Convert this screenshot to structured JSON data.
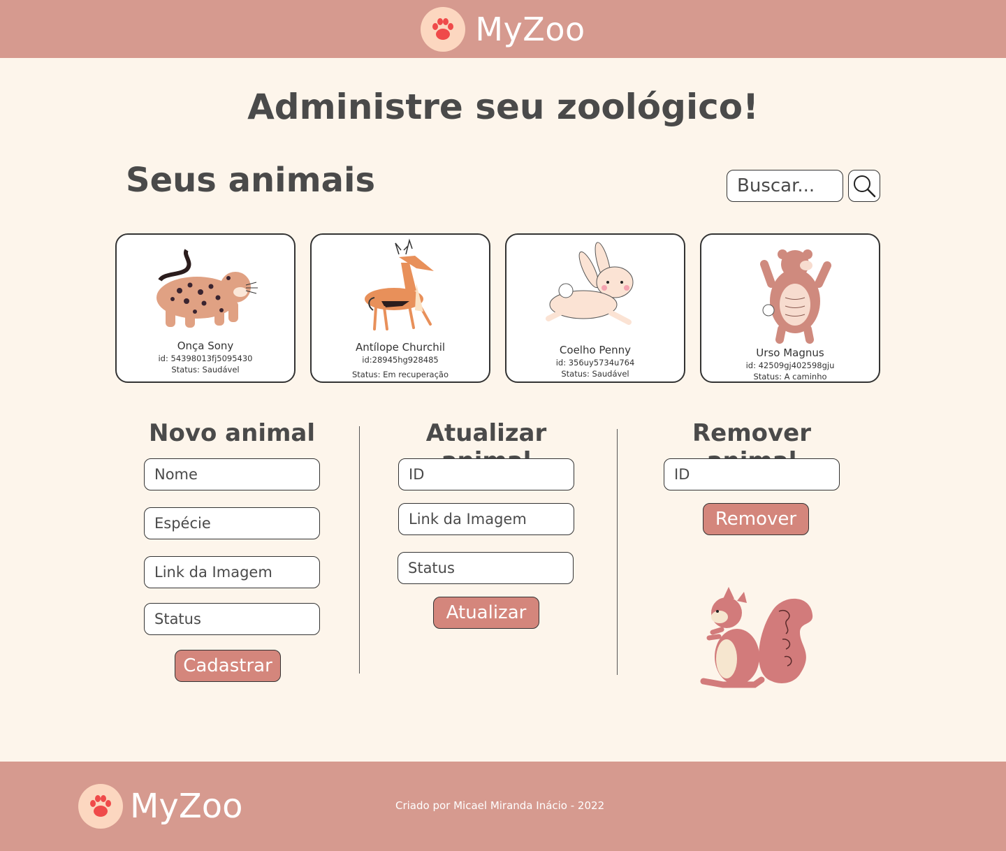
{
  "header": {
    "brand": "MyZoo"
  },
  "page": {
    "title": "Administre seu zoológico!"
  },
  "animals_section": {
    "title": "Seus animais",
    "search_placeholder": "Buscar..."
  },
  "animals": [
    {
      "name": "Onça Sony",
      "id": "id: 54398013fj5095430",
      "status": "Status: Saudável",
      "icon": "jaguar-illustration"
    },
    {
      "name": "Antílope Churchil",
      "id": "id:28945hg928485",
      "status": "Status: Em recuperação",
      "icon": "antelope-illustration"
    },
    {
      "name": "Coelho Penny",
      "id": "id: 356uy5734u764",
      "status": "Status: Saudável",
      "icon": "rabbit-illustration"
    },
    {
      "name": "Urso Magnus",
      "id": "id: 42509gj402598gju",
      "status": "Status: A caminho",
      "icon": "bear-illustration"
    }
  ],
  "new_animal": {
    "title": "Novo animal",
    "name_placeholder": "Nome",
    "species_placeholder": "Espécie",
    "image_placeholder": "Link da Imagem",
    "status_placeholder": "Status",
    "submit_label": "Cadastrar"
  },
  "update_animal": {
    "title": "Atualizar animal",
    "id_placeholder": "ID",
    "image_placeholder": "Link da Imagem",
    "status_placeholder": "Status",
    "submit_label": "Atualizar"
  },
  "remove_animal": {
    "title": "Remover animal",
    "id_placeholder": "ID",
    "submit_label": "Remover"
  },
  "footer": {
    "brand": "MyZoo",
    "credit": "Criado por Micael Miranda Inácio - 2022"
  },
  "colors": {
    "header_bg": "#d69a8f",
    "page_bg": "#fdf5eb",
    "button_bg": "#d4867c",
    "paw": "#ef4a4a"
  }
}
